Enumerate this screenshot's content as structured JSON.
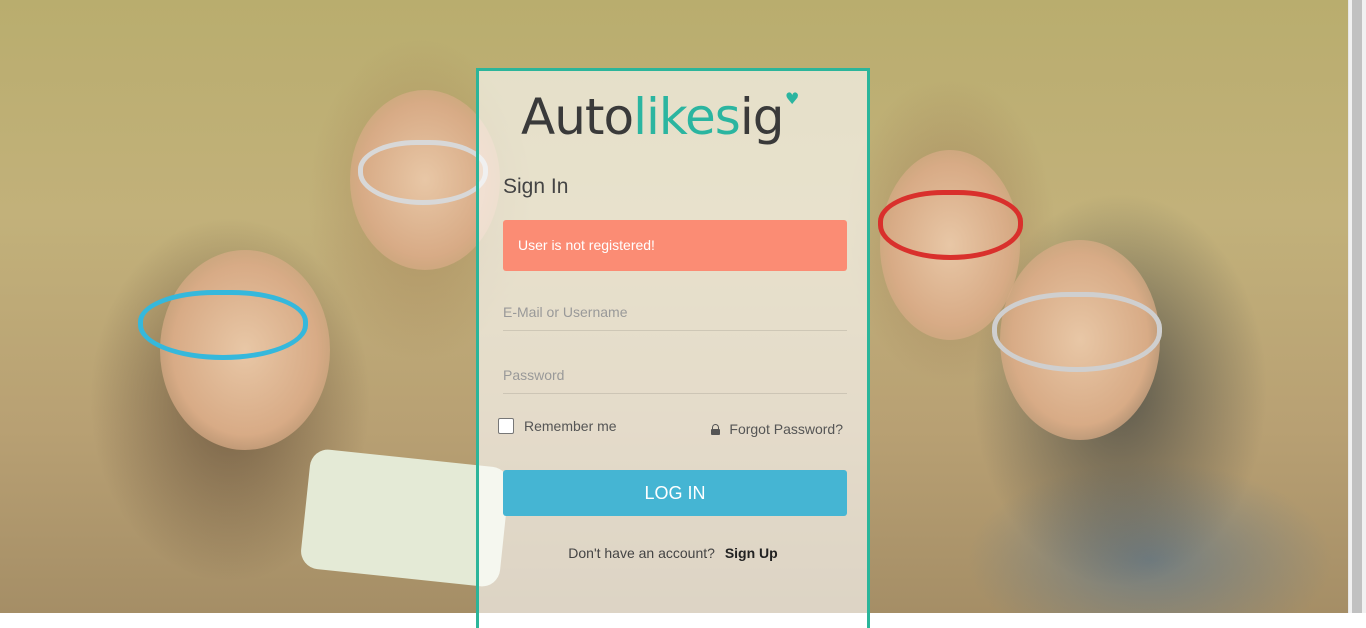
{
  "logo": {
    "part1": "Auto",
    "part2": "likes",
    "part3": "ig"
  },
  "form": {
    "title": "Sign In",
    "alert": "User is not registered!",
    "email_placeholder": "E-Mail or Username",
    "password_placeholder": "Password",
    "remember_label": "Remember me",
    "forgot_label": "Forgot Password?",
    "login_label": "LOG IN",
    "no_account_text": "Don't have an account?",
    "signup_label": "Sign Up"
  },
  "colors": {
    "accent": "#2bb59a",
    "alert": "#fb8c74",
    "button": "#45b5d3"
  }
}
